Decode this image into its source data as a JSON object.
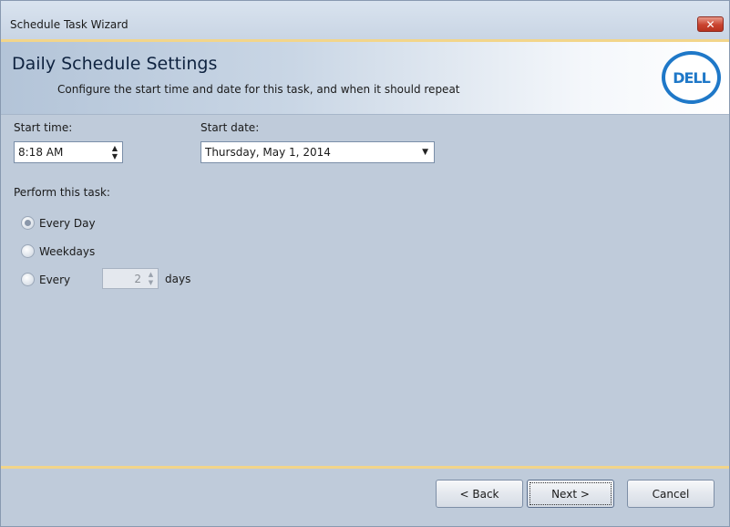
{
  "window": {
    "title": "Schedule Task Wizard"
  },
  "header": {
    "title": "Daily Schedule Settings",
    "subtitle": "Configure the start time and date for this task, and when it should repeat",
    "logo_text": "DELL"
  },
  "form": {
    "start_time_label": "Start time:",
    "start_time_value": "8:18 AM",
    "start_date_label": "Start date:",
    "start_date_value": "Thursday, May 1, 2014",
    "perform_label": "Perform this task:",
    "options": [
      {
        "label": "Every Day",
        "checked": true
      },
      {
        "label": "Weekdays",
        "checked": false
      },
      {
        "label": "Every",
        "checked": false
      }
    ],
    "every_days_value": "2",
    "days_label": "days"
  },
  "buttons": {
    "back": "< Back",
    "next": "Next >",
    "cancel": "Cancel"
  },
  "icons": {
    "close": "close-icon",
    "spin": "spin-arrows-icon",
    "dropdown": "chevron-down-icon"
  },
  "colors": {
    "accent": "#f2d58a",
    "background": "#bfcbda",
    "logo": "#1f78c8"
  }
}
